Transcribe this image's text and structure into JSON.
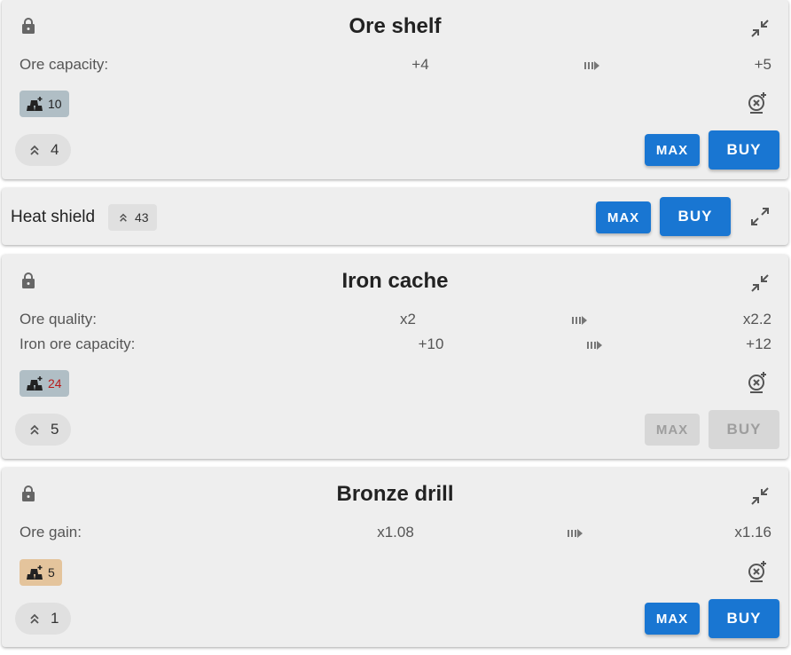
{
  "cards": [
    {
      "title": "Ore shelf",
      "stats": [
        {
          "label": "Ore capacity:",
          "current": "+4",
          "next": "+5"
        }
      ],
      "cost": {
        "value": "10",
        "style": "silver",
        "affordable": true
      },
      "level": "4",
      "max_label": "MAX",
      "buy_label": "BUY",
      "buttons_enabled": true
    },
    {
      "title": "Heat shield",
      "collapsed": true,
      "level": "43",
      "max_label": "MAX",
      "buy_label": "BUY",
      "buttons_enabled": true
    },
    {
      "title": "Iron cache",
      "stats": [
        {
          "label": "Ore quality:",
          "current": "x2",
          "next": "x2.2"
        },
        {
          "label": "Iron ore capacity:",
          "current": "+10",
          "next": "+12"
        }
      ],
      "cost": {
        "value": "24",
        "style": "silver",
        "affordable": false
      },
      "level": "5",
      "max_label": "MAX",
      "buy_label": "BUY",
      "buttons_enabled": false
    },
    {
      "title": "Bronze drill",
      "stats": [
        {
          "label": "Ore gain:",
          "current": "x1.08",
          "next": "x1.16"
        }
      ],
      "cost": {
        "value": "5",
        "style": "bronze",
        "affordable": true
      },
      "level": "1",
      "max_label": "MAX",
      "buy_label": "BUY",
      "buttons_enabled": true
    }
  ],
  "colors": {
    "primary": "#1976d2",
    "card_bg": "#eeeeee",
    "silver_chip": "#b0bec5",
    "bronze_chip": "#e4c49c",
    "insufficient": "#b71c1c"
  },
  "icons": {
    "lock": "lock-icon",
    "collapse": "collapse-icon",
    "expand": "expand-icon",
    "arrow": "arrow-right-dashed-icon",
    "ore": "ore-bars-icon",
    "target": "target-icon",
    "level_up": "double-chevron-up-icon"
  }
}
